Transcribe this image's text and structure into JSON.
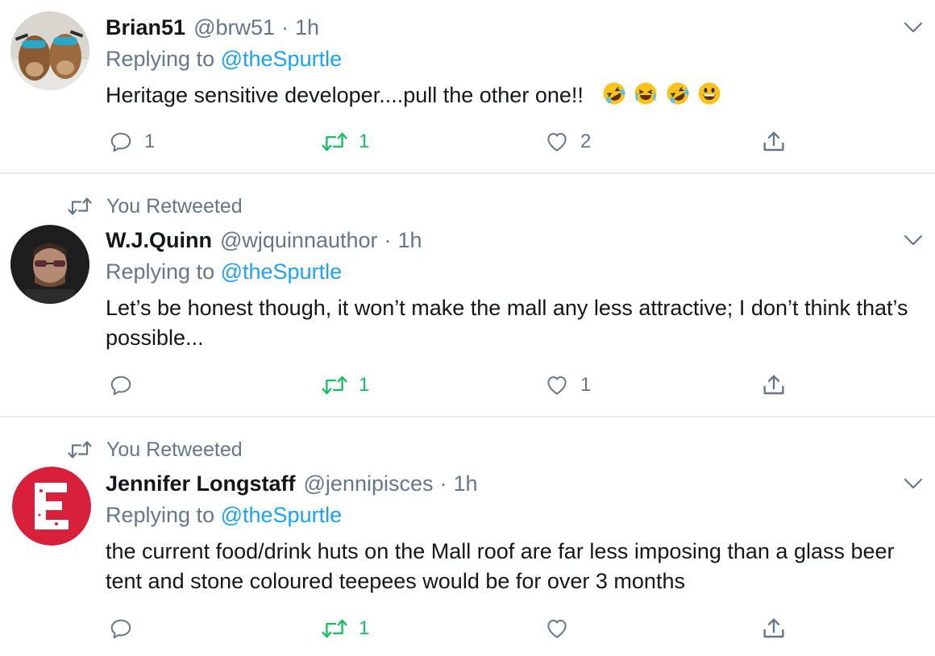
{
  "colors": {
    "accent": "#1da1f2",
    "retweeted": "#17bf63",
    "secondary_text": "#657786",
    "divider": "#e6ecf0"
  },
  "tweets": [
    {
      "retweet_context": "",
      "display_name": "Brian51",
      "handle": "@brw51",
      "separator": "·",
      "time": "1h",
      "replying_prefix": "Replying to",
      "replying_to": "@theSpurtle",
      "text": "Heritage sensitive developer....pull the other one!!",
      "emojis": [
        "rolling-on-floor-laughing-emoji",
        "loudly-crying-laughing-emoji",
        "rolling-on-floor-laughing-emoji",
        "grinning-face-emoji"
      ],
      "reply_count": "1",
      "retweet_count": "1",
      "like_count": "2",
      "avatar": "two-dogs-with-sunglasses-photo"
    },
    {
      "retweet_context": "You Retweeted",
      "display_name": "W.J.Quinn",
      "handle": "@wjquinnauthor",
      "separator": "·",
      "time": "1h",
      "replying_prefix": "Replying to",
      "replying_to": "@theSpurtle",
      "text": "Let’s be honest though, it won’t make the mall any less attractive; I don’t think that’s possible...",
      "reply_count": "",
      "retweet_count": "1",
      "like_count": "1",
      "avatar": "man-with-glasses-photo"
    },
    {
      "retweet_context": "You Retweeted",
      "display_name": "Jennifer Longstaff",
      "handle": "@jennipisces",
      "separator": "·",
      "time": "1h",
      "replying_prefix": "Replying to",
      "replying_to": "@theSpurtle",
      "text": "the current food/drink huts on the Mall roof are far less imposing than a glass beer tent and stone coloured teepees would be for over 3 months",
      "reply_count": "",
      "retweet_count": "1",
      "like_count": "",
      "avatar": "red-letter-e-logo"
    }
  ]
}
